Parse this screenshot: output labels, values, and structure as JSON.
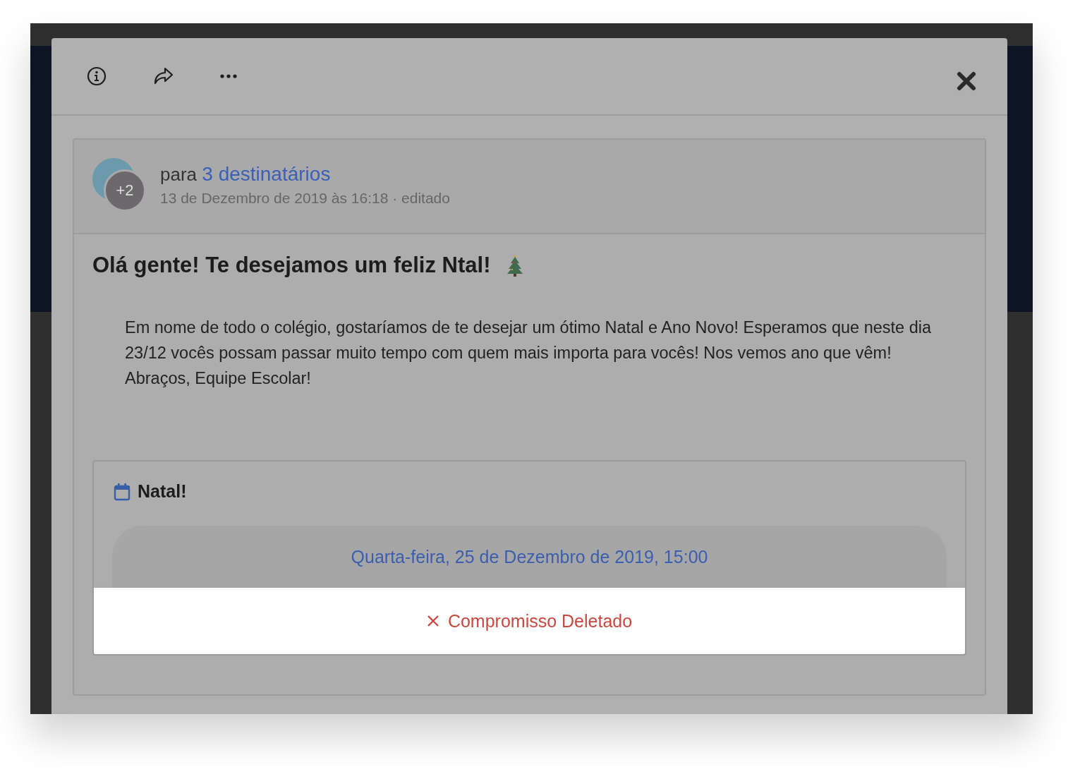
{
  "post": {
    "avatar_badge": "+2",
    "recipients_prefix": "para",
    "recipients_link": "3 destinatários",
    "meta": "13 de Dezembro de 2019 às 16:18 · editado",
    "title": "Olá gente! Te desejamos um feliz Ntal!",
    "body": "Em nome de todo o colégio, gostaríamos de te desejar um ótimo Natal e Ano Novo! Esperamos que neste dia 23/12 vocês possam passar muito tempo com quem mais importa para vocês! Nos vemos ano que vêm! Abraços, Equipe Escolar!"
  },
  "event": {
    "title": "Natal!",
    "datetime": "Quarta-feira, 25 de Dezembro de 2019, 15:00",
    "deleted": true,
    "status": "Compromisso Deletado"
  }
}
